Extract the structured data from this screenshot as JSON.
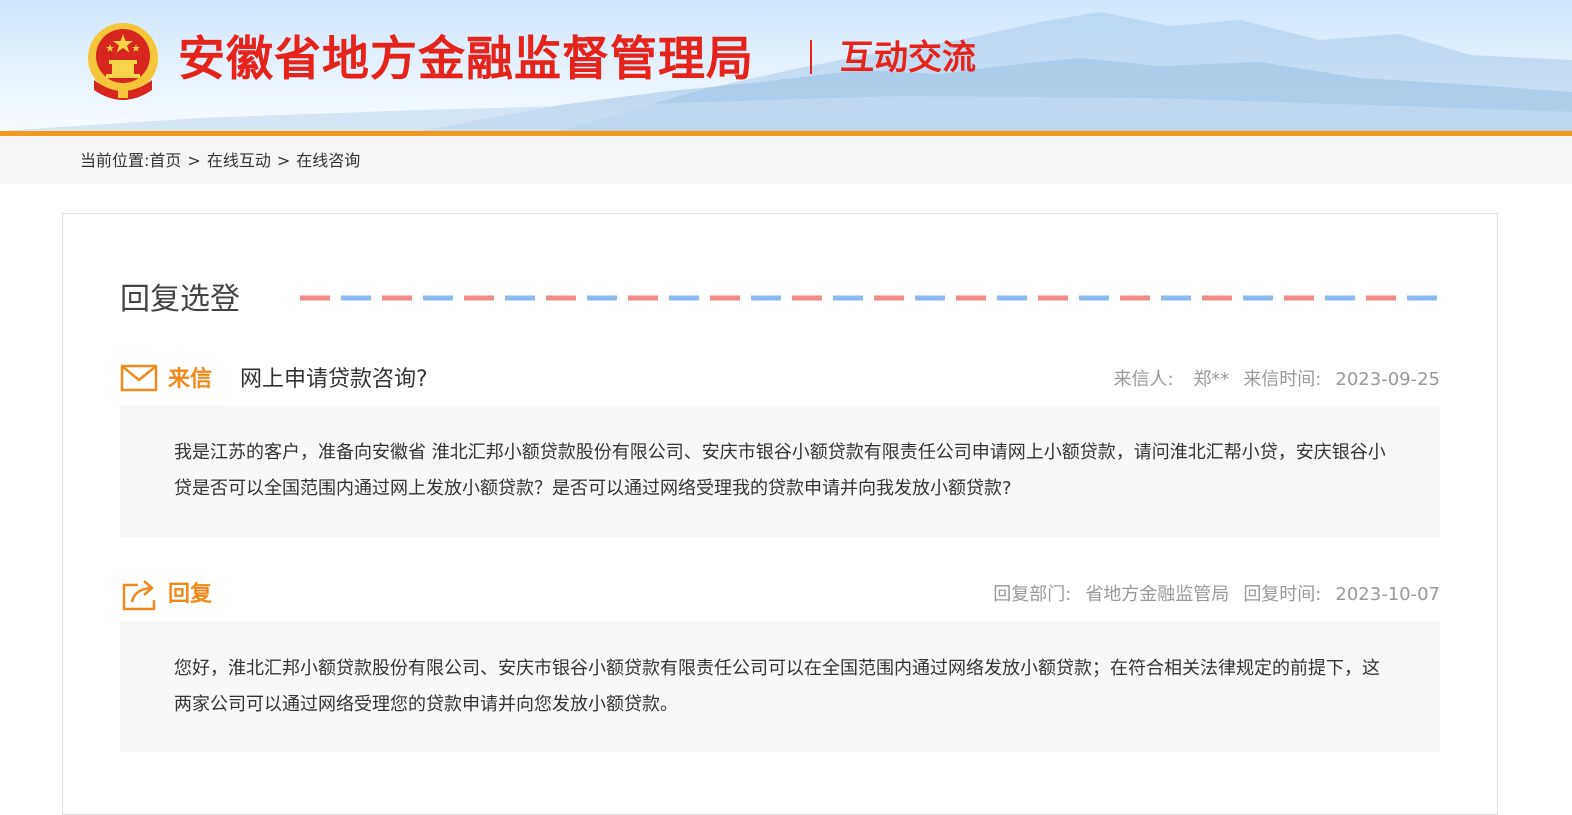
{
  "header": {
    "site_title": "安徽省地方金融监督管理局",
    "section_title": "互动交流",
    "colors": {
      "title_red": "#e5231b",
      "accent_orange": "#f39a1e"
    },
    "emblem_icon": "national-emblem-icon"
  },
  "breadcrumb": {
    "prefix": "当前位置:",
    "items": [
      "首页",
      "在线互动",
      "在线咨询"
    ],
    "separator": ">"
  },
  "main": {
    "heading": "回复选登",
    "letter": {
      "tag": "来信",
      "icon": "envelope-icon",
      "subject": "网上申请贷款咨询?",
      "sender_label": "来信人:",
      "sender": "郑**",
      "time_label": "来信时间:",
      "time": "2023-09-25",
      "body": "我是江苏的客户，准备向安徽省 淮北汇邦小额贷款股份有限公司、安庆市银谷小额贷款有限责任公司申请网上小额贷款，请问淮北汇帮小贷，安庆银谷小贷是否可以全国范围内通过网上发放小额贷款？是否可以通过网络受理我的贷款申请并向我发放小额贷款?"
    },
    "reply": {
      "tag": "回复",
      "icon": "reply-share-icon",
      "dept_label": "回复部门:",
      "dept": "省地方金融监管局",
      "time_label": "回复时间:",
      "time": "2023-10-07",
      "body": "您好，淮北汇邦小额贷款股份有限公司、安庆市银谷小额贷款有限责任公司可以在全国范围内通过网络发放小额贷款；在符合相关法律规定的前提下，这两家公司可以通过网络受理您的贷款申请并向您发放小额贷款。"
    }
  }
}
